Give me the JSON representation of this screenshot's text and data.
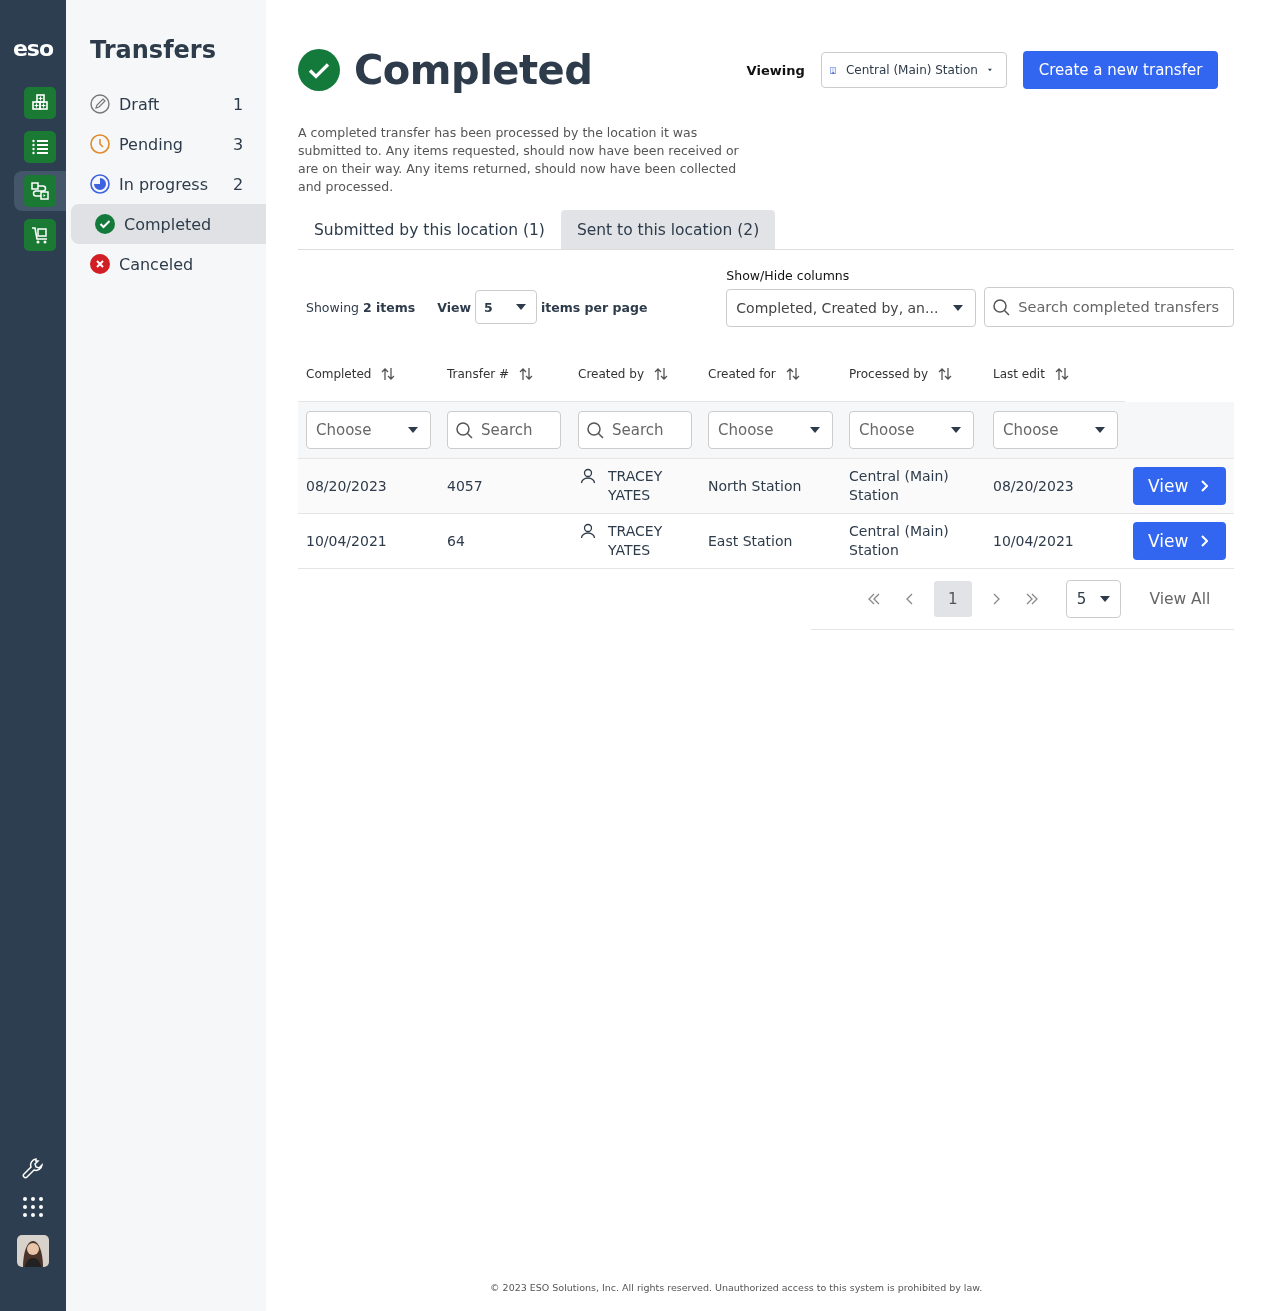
{
  "rail": {
    "logo": "eso",
    "nav": [
      {
        "kind": "supplies",
        "selected": false
      },
      {
        "kind": "list",
        "selected": false
      },
      {
        "kind": "transfers",
        "selected": true
      },
      {
        "kind": "cart",
        "selected": false
      }
    ]
  },
  "sidebar": {
    "title": "Transfers",
    "items": [
      {
        "label": "Draft",
        "count": "1",
        "kind": "draft",
        "selected": false
      },
      {
        "label": "Pending",
        "count": "3",
        "kind": "pending",
        "selected": false
      },
      {
        "label": "In progress",
        "count": "2",
        "kind": "in_progress",
        "selected": false
      },
      {
        "label": "Completed",
        "kind": "completed",
        "selected": true
      },
      {
        "label": "Canceled",
        "kind": "canceled",
        "selected": false
      }
    ]
  },
  "header": {
    "title": "Completed",
    "viewing_label": "Viewing",
    "location": "Central (Main) Station",
    "create_button": "Create a new transfer"
  },
  "description": "A completed transfer has been processed by the location it was submitted to. Any items requested, should now have been received or are on their way. Any items returned, should now have been collected and processed.",
  "tabs": [
    {
      "label": "Submitted by this location (1)",
      "selected": false
    },
    {
      "label": "Sent to this location (2)",
      "selected": true
    }
  ],
  "toolbar": {
    "showing": "Showing **2 items**",
    "view_label": "View",
    "per_page": "5",
    "per_page_suffix": "items per page",
    "columns_label": "Show/Hide columns",
    "columns_value": "Completed, Created by, an...",
    "search_placeholder": "Search completed transfers"
  },
  "table": {
    "columns": [
      {
        "label": "Completed",
        "kind": "choose",
        "filter": "Choose"
      },
      {
        "label": "Transfer #",
        "kind": "search",
        "filter": "Search"
      },
      {
        "label": "Created by",
        "kind": "search",
        "filter": "Search"
      },
      {
        "label": "Created for",
        "kind": "choose",
        "filter": "Choose"
      },
      {
        "label": "Processed by",
        "kind": "choose",
        "filter": "Choose"
      },
      {
        "label": "Last edit",
        "kind": "choose",
        "filter": "Choose"
      }
    ],
    "rows": [
      {
        "completed": "08/20/2023",
        "transfer": "4057",
        "created_by": "TRACEY YATES",
        "created_for": "North Station",
        "processed_by": "Central (Main) Station",
        "last_edit": "08/20/2023",
        "action": "View"
      },
      {
        "completed": "10/04/2021",
        "transfer": "64",
        "created_by": "TRACEY YATES",
        "created_for": "East Station",
        "processed_by": "Central (Main) Station",
        "last_edit": "10/04/2021",
        "action": "View"
      }
    ]
  },
  "pagination": {
    "pages": [
      {
        "label": "1",
        "selected": true
      }
    ],
    "page_size": "5",
    "view_all": "View All"
  },
  "footer": "© 2023 ESO Solutions, Inc. All rights reserved. Unauthorized access to this system is prohibited by law."
}
